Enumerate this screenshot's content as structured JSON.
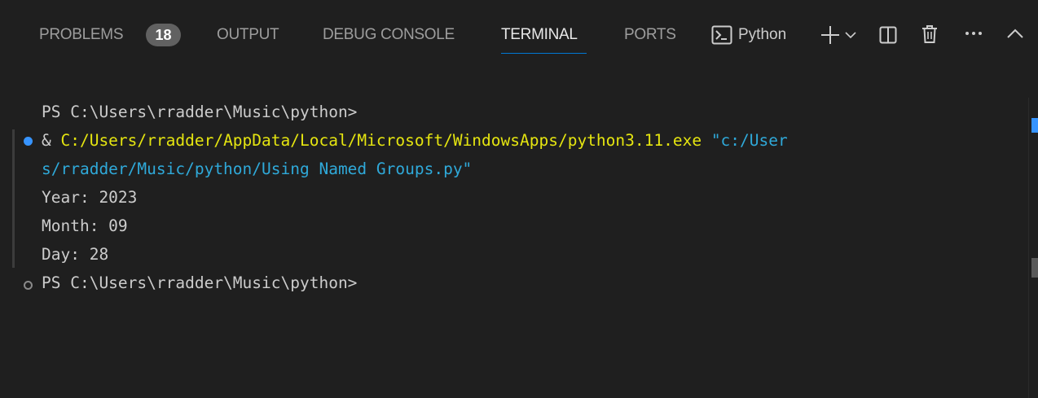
{
  "tabs": {
    "problems": "PROBLEMS",
    "problems_count": "18",
    "output": "OUTPUT",
    "debug_console": "DEBUG CONSOLE",
    "terminal": "TERMINAL",
    "ports": "PORTS"
  },
  "toolbar": {
    "terminal_profile": "Python",
    "more": "···"
  },
  "terminal": {
    "prompt1": "PS C:\\Users\\rradder\\Music\\python>",
    "cmd_amp": "& ",
    "cmd_exe": "C:/Users/rradder/AppData/Local/Microsoft/WindowsApps/python3.11.exe",
    "cmd_arg_part1": " \"c:/User",
    "cmd_arg_part2": "s/rradder/Music/python/Using Named Groups.py\"",
    "out_year": "Year: 2023",
    "out_month": "Month: 09",
    "out_day": "Day: 28",
    "prompt2": "PS C:\\Users\\rradder\\Music\\python>"
  },
  "colors": {
    "background": "#1f1f1f",
    "accent": "#0078d4",
    "exe_path": "#e5e510",
    "string_arg": "#2fa9d9",
    "success_dot": "#3794ff"
  }
}
